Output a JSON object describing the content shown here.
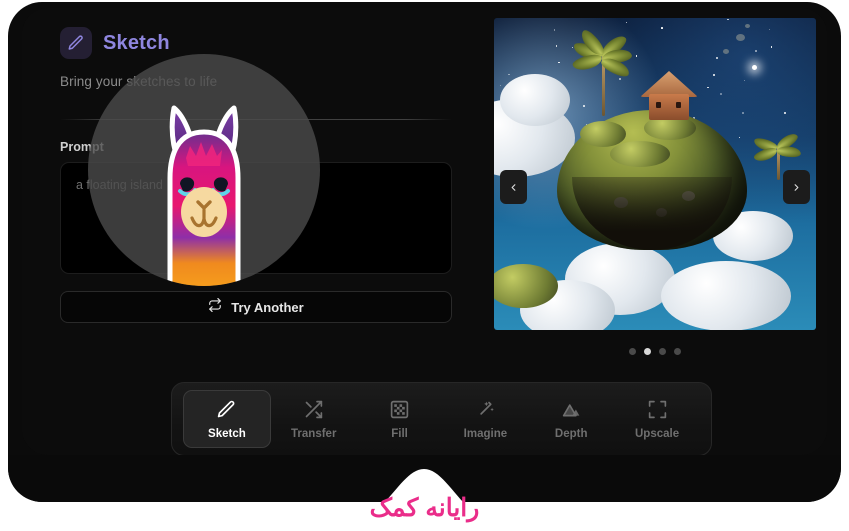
{
  "app": {
    "title": "Sketch",
    "subtitle": "Bring your sketches to life",
    "title_icon": "pencil-icon",
    "accent_color": "#8f86df"
  },
  "prompt": {
    "label": "Prompt",
    "value": "a floating island"
  },
  "actions": {
    "try_another": {
      "label": "Try Another",
      "icon": "repeat-icon"
    }
  },
  "preview": {
    "prev_icon": "chevron-left-icon",
    "next_icon": "chevron-right-icon",
    "dots": [
      {
        "active": false
      },
      {
        "active": true
      },
      {
        "active": false
      },
      {
        "active": false
      }
    ]
  },
  "toolbar": {
    "items": [
      {
        "label": "Sketch",
        "icon": "pencil-icon",
        "active": true
      },
      {
        "label": "Transfer",
        "icon": "shuffle-icon",
        "active": false
      },
      {
        "label": "Fill",
        "icon": "checkerboard-icon",
        "active": false
      },
      {
        "label": "Imagine",
        "icon": "magic-wand-icon",
        "active": false
      },
      {
        "label": "Depth",
        "icon": "mountain-icon",
        "active": false
      },
      {
        "label": "Upscale",
        "icon": "expand-icon",
        "active": false
      }
    ]
  },
  "watermark": {
    "llama_logo": "llama-mascot-icon",
    "brand_text": "رایانه کمک",
    "brand_color": "#ea2d8a"
  }
}
